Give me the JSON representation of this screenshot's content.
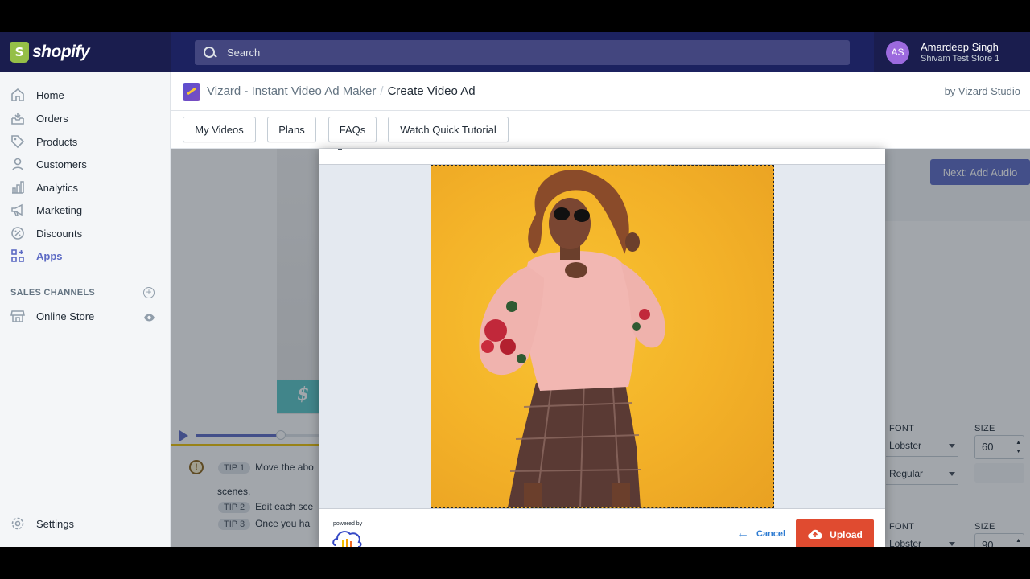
{
  "topbar": {
    "logo_glyph": "S",
    "logo_text": "shopify",
    "search_placeholder": "Search",
    "user": {
      "initials": "AS",
      "name": "Amardeep Singh",
      "store": "Shivam Test Store 1"
    }
  },
  "sidebar": {
    "items": [
      {
        "label": "Home",
        "icon": "home-icon"
      },
      {
        "label": "Orders",
        "icon": "orders-icon"
      },
      {
        "label": "Products",
        "icon": "tag-icon"
      },
      {
        "label": "Customers",
        "icon": "person-icon"
      },
      {
        "label": "Analytics",
        "icon": "chart-icon"
      },
      {
        "label": "Marketing",
        "icon": "megaphone-icon"
      },
      {
        "label": "Discounts",
        "icon": "discount-icon"
      },
      {
        "label": "Apps",
        "icon": "apps-icon",
        "active": true
      }
    ],
    "sales_channels_heading": "SALES CHANNELS",
    "online_store": "Online Store",
    "settings": "Settings"
  },
  "header": {
    "app_name": "Vizard - Instant Video Ad Maker",
    "separator": "/",
    "page_title": "Create Video Ad",
    "by_line": "by Vizard Studio"
  },
  "toolbar": {
    "my_videos": "My Videos",
    "plans": "Plans",
    "faqs": "FAQs",
    "tutorial": "Watch Quick Tutorial"
  },
  "background": {
    "next_button": "Next: Add Audio",
    "tips": [
      {
        "badge": "TIP 1",
        "text": "Move the abo"
      },
      {
        "badge": "TIP 2",
        "text": "Edit each sce"
      },
      {
        "badge": "TIP 3",
        "text": "Once you ha"
      }
    ],
    "tip1_continuation": "scenes.",
    "text_settings": [
      {
        "font_label": "FONT",
        "size_label": "SIZE",
        "font": "Lobster",
        "style": "Regular",
        "size": "60"
      },
      {
        "font_label": "FONT",
        "size_label": "SIZE",
        "font": "Lobster",
        "size": "90"
      }
    ],
    "preview_text": "$"
  },
  "modal": {
    "powered_by": "powered by",
    "cancel": "Cancel",
    "upload": "Upload"
  },
  "colors": {
    "topbar": "#1c2260",
    "accent": "#5c6ac4",
    "upload": "#e04b30",
    "shopify_green": "#95bf47"
  }
}
